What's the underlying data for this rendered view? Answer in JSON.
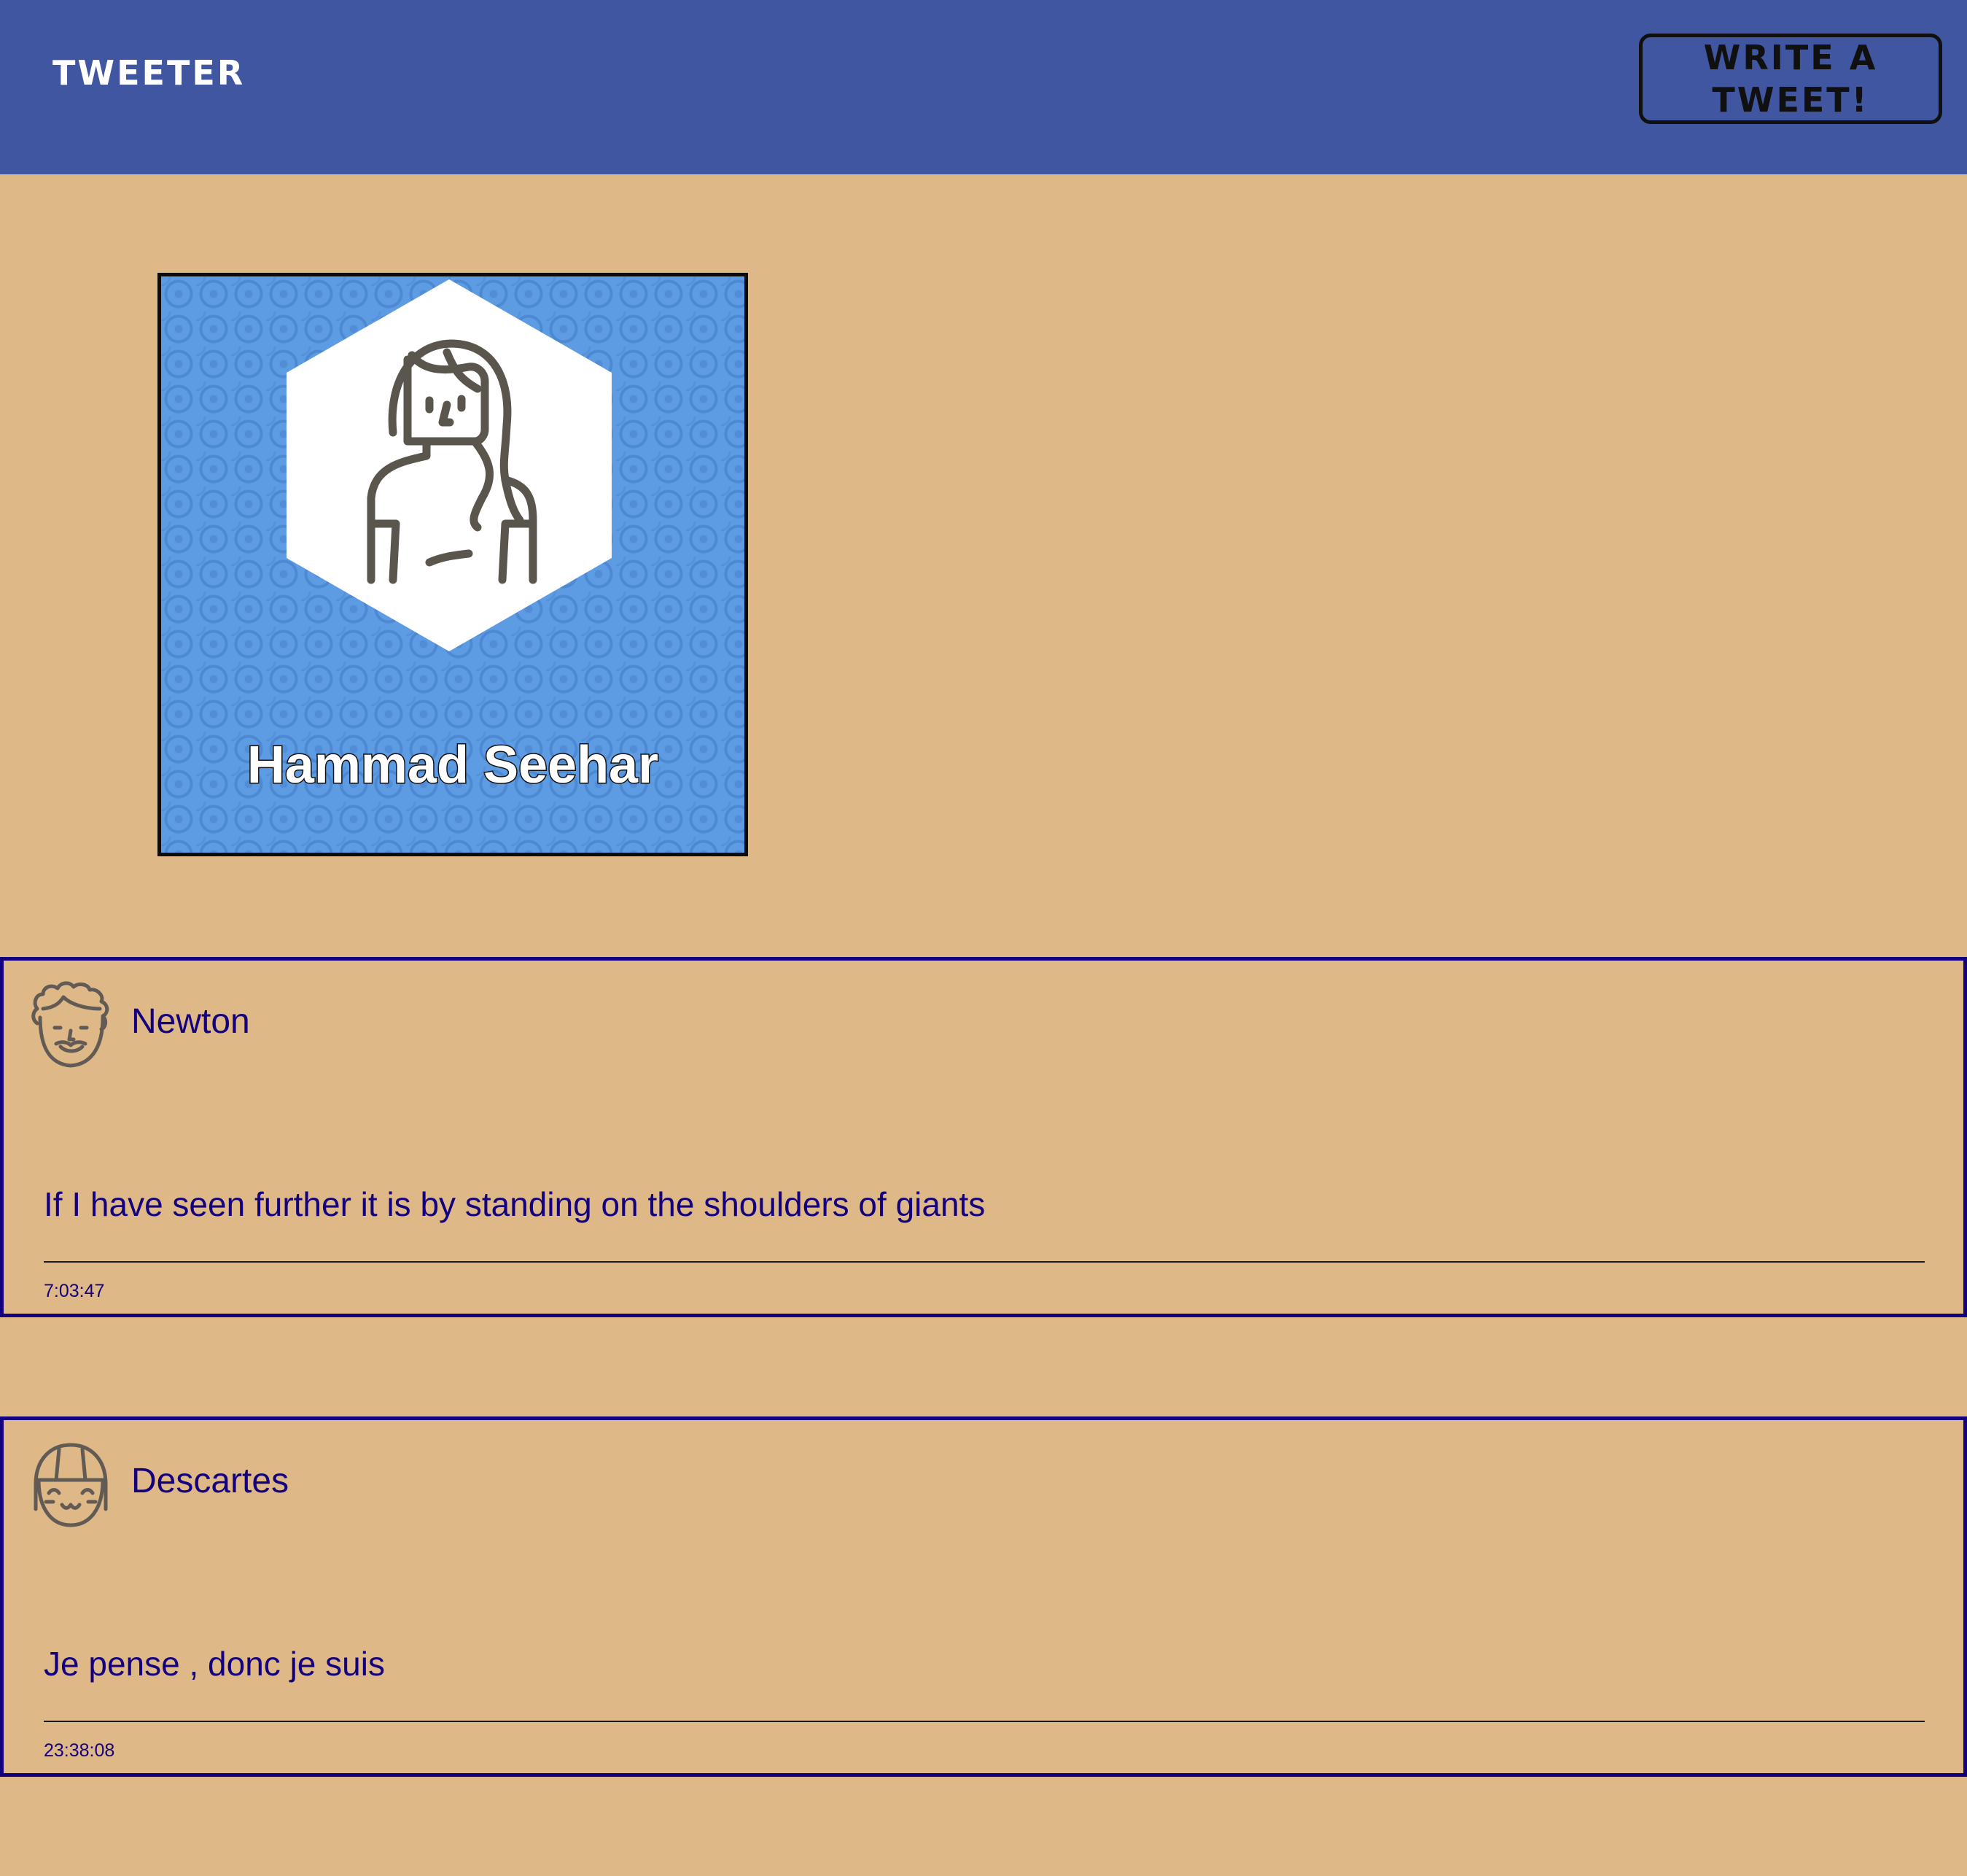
{
  "header": {
    "brand": "Tweeter",
    "write_button": "Write a Tweet!"
  },
  "profile": {
    "name": "Hammad Seehar",
    "avatar_icon": "woman-avatar-icon"
  },
  "tweets": [
    {
      "author": "Newton",
      "avatar_icon": "curly-hair-face-icon",
      "text": "If I have seen further it is by standing on the shoulders of giants",
      "time": "7:03:47"
    },
    {
      "author": "Descartes",
      "avatar_icon": "bob-hair-smiling-face-icon",
      "text": "Je pense , donc je suis",
      "time": "23:38:08"
    }
  ],
  "colors": {
    "page_background": "#deb887",
    "header_background": "#4156a1",
    "tweet_accent": "#14007e",
    "profile_background": "#5d9ce2"
  }
}
